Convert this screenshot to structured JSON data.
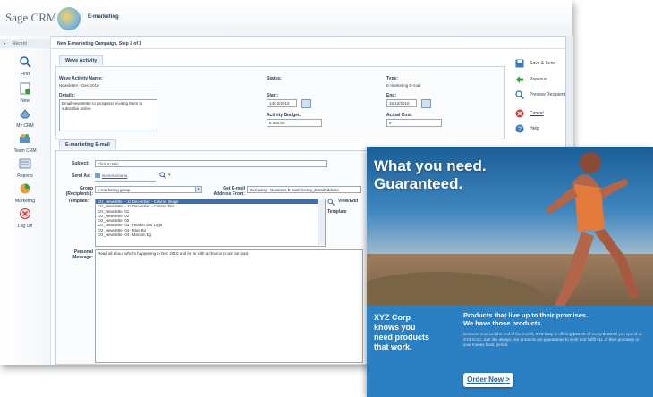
{
  "app": {
    "brand": "Sage CRM",
    "title": "E-marketing"
  },
  "sidebar": {
    "recent": "Recent",
    "items": [
      {
        "label": "Find",
        "icon": "magnifier-icon"
      },
      {
        "label": "New",
        "icon": "new-document-icon"
      },
      {
        "label": "My CRM",
        "icon": "my-crm-icon"
      },
      {
        "label": "Team CRM",
        "icon": "team-crm-icon"
      },
      {
        "label": "Reports",
        "icon": "reports-icon"
      },
      {
        "label": "Marketing",
        "icon": "marketing-icon"
      },
      {
        "label": "Log Off",
        "icon": "log-off-icon"
      }
    ]
  },
  "page": {
    "header": "New E-marketing Campaign, Step 3 of 3"
  },
  "wave": {
    "tab": "Wave Activity",
    "name_label": "Wave Activity Name:",
    "name_value": "Newsletter - Dec 2010",
    "details_label": "Details:",
    "details_value": "Email newsletter to prospects inviting them to subscribe online.",
    "status_label": "Status:",
    "start_label": "Start:",
    "start_value": "14/12/2010",
    "budget_label": "Activity Budget:",
    "budget_value": "€ 500.00",
    "type_label": "Type:",
    "type_value": "E-marketing E-mail",
    "end_label": "End:",
    "end_value": "15/12/2010",
    "cost_label": "Actual Cost:",
    "cost_value": "€"
  },
  "actions": [
    {
      "label": "Save & Send",
      "icon": "save-icon"
    },
    {
      "label": "Previous",
      "icon": "previous-arrow-icon"
    },
    {
      "label": "Preview Recipients",
      "icon": "preview-magnifier-icon"
    },
    {
      "label": "Cancel",
      "icon": "cancel-icon"
    },
    {
      "label": "Help",
      "icon": "help-icon"
    }
  ],
  "email": {
    "tab": "E-marketing E-mail",
    "subject_label": "Subject:",
    "subject_value": "Click to Win",
    "sendas_label": "Send As:",
    "sendas_value": "stevemontana",
    "group_label": "Group (Recipients):",
    "group_value": "e-marketing group",
    "getemail_label": "Get E-mail Address From:",
    "getemail_value": "Company - Business E-mail: Comp_EmailAddress",
    "template_label": "Template:",
    "templates": [
      "zzz_Newsletter - 12 December - Column Image",
      "zzz_Newsletter - 12 December - Column Text",
      "zzz_Newsletter 01",
      "zzz_Newsletter 02",
      "zzz_Newsletter 03",
      "zzz_Newsletter 03 - Header and Logo",
      "zzz_Newsletter 04 - Blue Bg",
      "zzz_Newsletter 04 - Maroon Bg"
    ],
    "view_edit_label": "View/Edit",
    "template_side_label": "Template",
    "message_label": "Personal Message:",
    "message_value": "Read all about what's happening in Dec 2010 and be in with a chance to win an ipad."
  },
  "ad": {
    "headline_1": "What you need.",
    "headline_2": "Guaranteed.",
    "left_lines": [
      "XYZ Corp",
      "knows you",
      "need products",
      "that work."
    ],
    "right_title_1": "Products that live up to their promises.",
    "right_title_2": "We have those products.",
    "right_body": "Between now and the end of the month, XYZ Corp is offering $15.00 off every $100.00 you spend at XYZ Corp. Just like always, our products are guaranteed to work and fulfill ALL of their promises or your money back, period.",
    "button": "Order Now >"
  },
  "colors": {
    "accent": "#2b7fc3",
    "selection": "#3f6fb0",
    "label": "#2b3e55"
  }
}
